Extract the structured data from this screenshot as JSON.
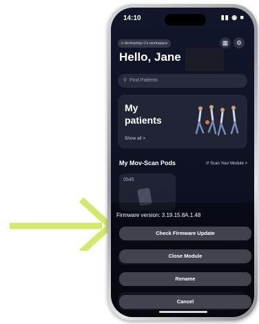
{
  "status_bar": {
    "time": "14:10",
    "icons": "▮▮ ◉ ■"
  },
  "header": {
    "workspace": "e.denhartog+1's workspace",
    "greeting": "Hello, Jane",
    "qr_icon": "qr-scan-icon",
    "settings_icon": "gear-icon"
  },
  "search": {
    "placeholder": "Find Patients",
    "icon": "search-icon"
  },
  "patients_card": {
    "title": "My patients",
    "show_all": "Show all >"
  },
  "pods_section": {
    "title": "My Mov-Scan Pods",
    "scan_link": "Scan Your Module >",
    "pod_code": "0545"
  },
  "sheet": {
    "firmware": "Firmware version: 3.19.15.8A.1.48",
    "check_update": "Check Firmware Update",
    "close_module": "Close Module",
    "rename": "Rename",
    "cancel": "Cancel"
  },
  "colors": {
    "arrow": "#d3e86a",
    "screen_bg": "#0f1326",
    "sheet_button": "#464854"
  }
}
